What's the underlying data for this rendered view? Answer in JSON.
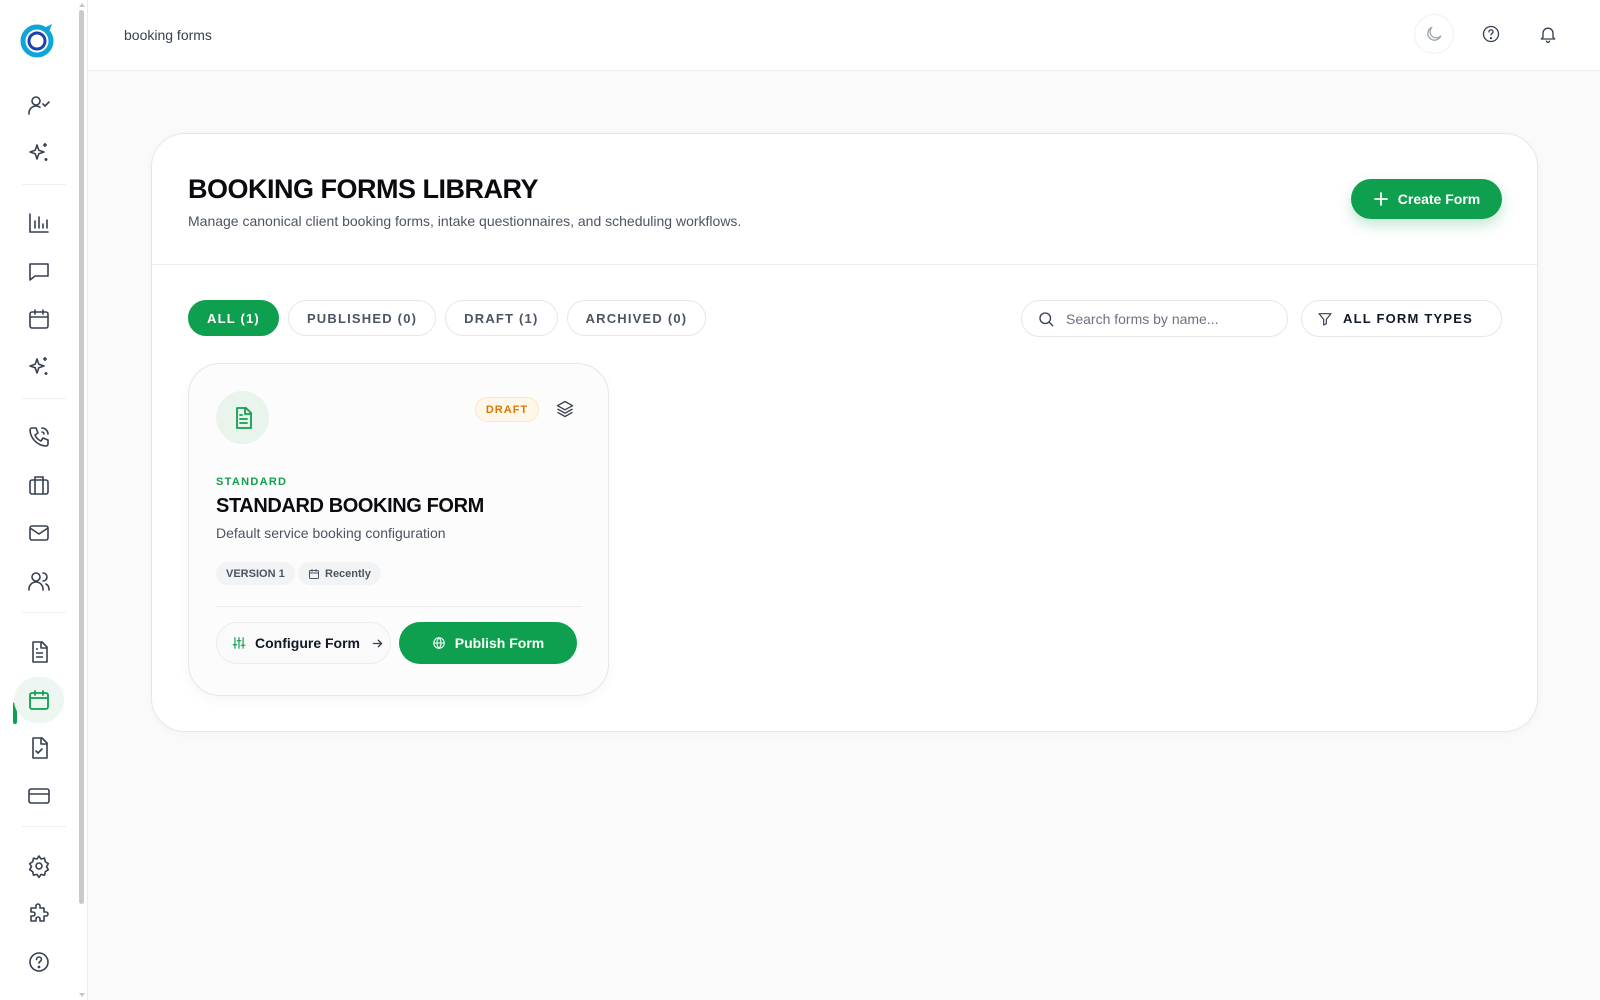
{
  "header": {
    "breadcrumb": "booking forms",
    "icons": [
      "moon-icon",
      "help-circle-icon",
      "bell-icon"
    ]
  },
  "sidebar": {
    "icons": [
      "user-check-icon",
      "sparkles-icon",
      "bar-chart-icon",
      "message-square-icon",
      "calendar-icon",
      "sparkles-icon",
      "phone-call-icon",
      "briefcase-icon",
      "mail-icon",
      "users-icon",
      "file-text-icon",
      "calendar-icon",
      "file-check-icon",
      "credit-card-icon",
      "settings-icon",
      "puzzle-icon",
      "help-circle-icon"
    ],
    "active": "calendar-icon"
  },
  "page": {
    "title": "BOOKING FORMS LIBRARY",
    "subtitle": "Manage canonical client booking forms, intake questionnaires, and scheduling workflows.",
    "create_label": "Create Form"
  },
  "tabs": [
    {
      "label": "ALL (1)",
      "active": true
    },
    {
      "label": "PUBLISHED (0)",
      "active": false
    },
    {
      "label": "DRAFT (1)",
      "active": false
    },
    {
      "label": "ARCHIVED (0)",
      "active": false
    }
  ],
  "search": {
    "placeholder": "Search forms by name...",
    "value": ""
  },
  "filter": {
    "label": "ALL FORM TYPES"
  },
  "forms": [
    {
      "status": "DRAFT",
      "type": "STANDARD",
      "name": "STANDARD BOOKING FORM",
      "description": "Default service booking configuration",
      "version": "VERSION 1",
      "updated": "Recently",
      "configure_label": "Configure Form",
      "publish_label": "Publish Form"
    }
  ],
  "colors": {
    "accent": "#0e9f4f",
    "draft": "#d97706",
    "background": "#fafafa"
  }
}
